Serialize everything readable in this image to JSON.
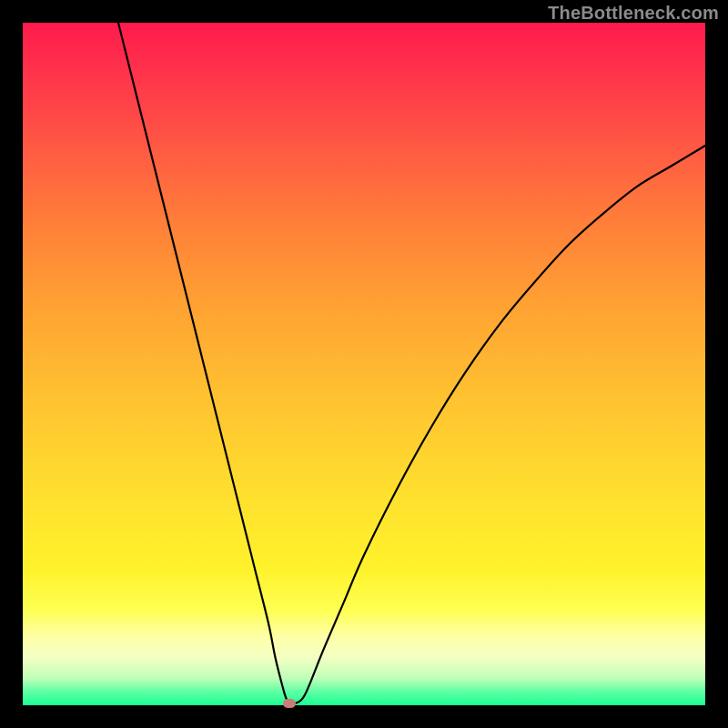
{
  "watermark": "TheBottleneck.com",
  "chart_data": {
    "type": "line",
    "title": "",
    "xlabel": "",
    "ylabel": "",
    "xlim": [
      0,
      100
    ],
    "ylim": [
      0,
      100
    ],
    "x": [
      14,
      16,
      18,
      20,
      22,
      24,
      26,
      28,
      30,
      32,
      34,
      36,
      37,
      38,
      38.6,
      39.2,
      40,
      41,
      42,
      44,
      47,
      50,
      55,
      60,
      65,
      70,
      75,
      80,
      85,
      90,
      95,
      100
    ],
    "y": [
      100,
      92,
      84,
      76,
      68,
      60,
      52,
      44,
      36,
      28,
      20,
      12,
      7,
      3,
      1,
      0.3,
      0.3,
      1,
      3,
      8,
      15,
      22,
      32,
      41,
      49,
      56,
      62,
      67.5,
      72,
      76,
      79,
      82
    ],
    "marker": {
      "x": 39,
      "y": 0.3,
      "color": "#cd7a7a"
    },
    "gradient": {
      "top_color": "#ff1a4d",
      "mid_color": "#ffe12e",
      "bottom_color": "#1aff95"
    }
  }
}
